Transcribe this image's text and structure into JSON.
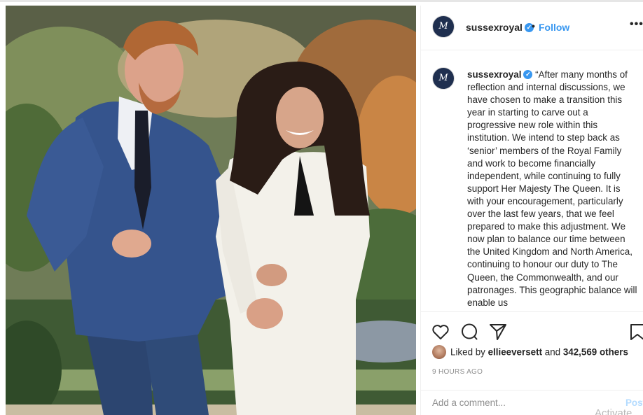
{
  "post": {
    "username": "sussexroyal",
    "monogram": "M",
    "follow_label": "Follow",
    "separator": "•",
    "more_label": "•••",
    "caption": "“After many months of reflection and internal discussions, we have chosen to make a transition this year in starting to carve out a progressive new role within this institution. We intend to step back as ‘senior’ members of the Royal Family and work to become financially independent, while continuing to fully support Her Majesty The Queen. It is with your encouragement, particularly over the last few years, that we feel prepared to make this adjustment. We now plan to balance our time between the United Kingdom and North America, continuing to honour our duty to The Queen, the Commonwealth, and our patronages. This geographic balance will enable us",
    "liked_by_prefix": "Liked by",
    "liked_by_user": "ellieeversett",
    "and_label": "and",
    "others_count": "342,569 others",
    "timestamp": "9 HOURS AGO",
    "comment_placeholder": "Add a comment...",
    "post_label": "Post",
    "watermark": "Activate"
  },
  "icons": {
    "like": "heart-icon",
    "comment": "comment-icon",
    "share": "paper-plane-icon",
    "save": "bookmark-icon",
    "verified": "verified-badge-icon"
  },
  "colors": {
    "link_blue": "#3897f0",
    "post_disabled": "#b3dbff",
    "text": "#262626",
    "muted": "#8e8e8e"
  }
}
